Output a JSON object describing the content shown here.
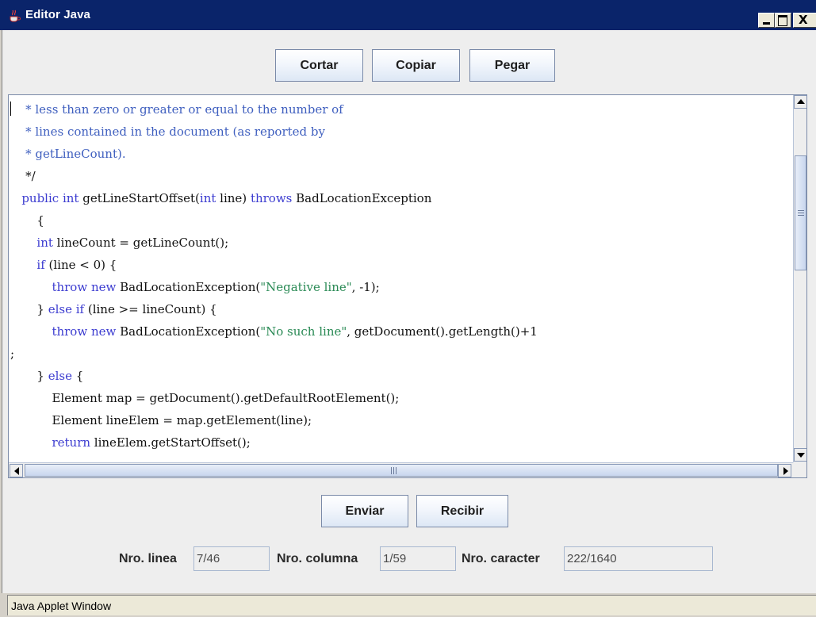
{
  "window": {
    "title": "Editor Java",
    "close_symbol": "X"
  },
  "toolbar": {
    "cut_label": "Cortar",
    "copy_label": "Copiar",
    "paste_label": "Pegar"
  },
  "editor": {
    "lines": [
      "    * less than zero or greater or equal to the number of",
      "    * lines contained in the document (as reported by",
      "    * getLineCount).",
      "    */",
      "   public int getLineStartOffset(int line) throws BadLocationException",
      "       {",
      "       int lineCount = getLineCount();",
      "       if (line < 0) {",
      "           throw new BadLocationException(\"Negative line\", -1);",
      "       } else if (line >= lineCount) {",
      "           throw new BadLocationException(\"No such line\", getDocument().getLength()+1",
      ";",
      "       } else {",
      "           Element map = getDocument().getDefaultRootElement();",
      "           Element lineElem = map.getElement(line);",
      "           return lineElem.getStartOffset();"
    ]
  },
  "actions": {
    "send_label": "Enviar",
    "receive_label": "Recibir"
  },
  "status": {
    "line_label": "Nro. linea",
    "line_value": "7/46",
    "column_label": "Nro. columna",
    "column_value": "1/59",
    "char_label": "Nro. caracter",
    "char_value": "222/1640"
  },
  "footer": {
    "applet_label": "Java Applet Window"
  },
  "icons": {
    "app": "java-cup-icon",
    "minimize": "minimize-icon",
    "maximize": "maximize-icon",
    "close": "close-icon"
  },
  "colors": {
    "titlebar": "#0a246a",
    "comment": "#3f5fbf",
    "keyword": "#3c3cd0",
    "string": "#2a8a55",
    "button_border": "#7a8aa8"
  }
}
